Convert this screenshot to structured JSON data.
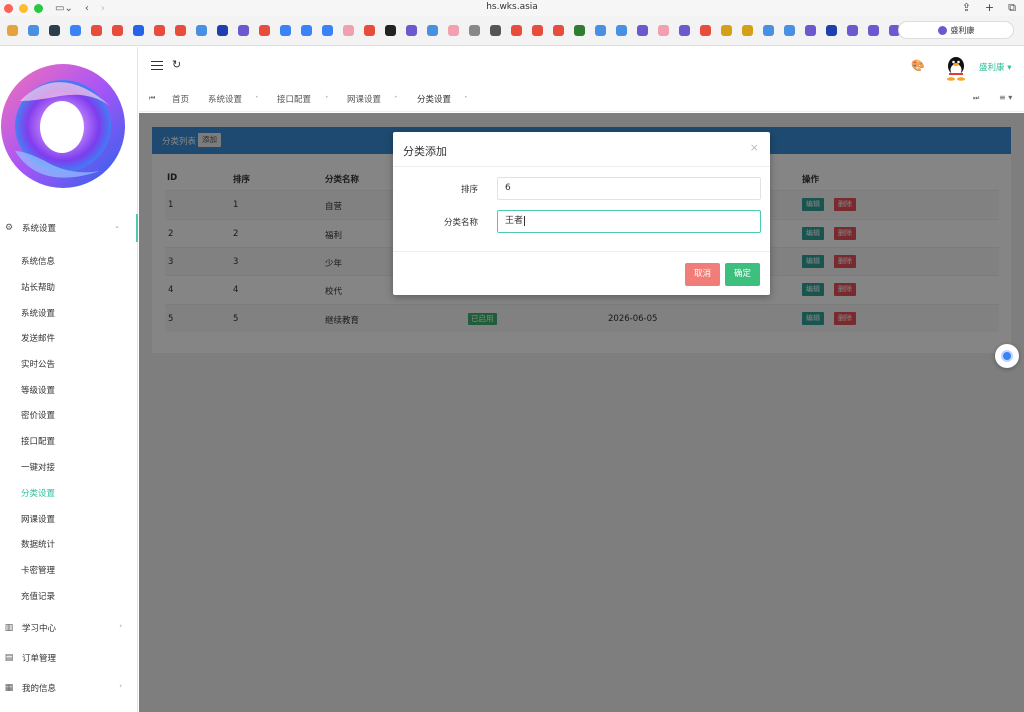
{
  "browser": {
    "url": "hs.wks.asia",
    "search_label": "盛利康"
  },
  "colors": {
    "accent": "#2fbf9a",
    "panel_header": "#3a8fd9",
    "danger": "#e8515a",
    "edit": "#2fa39a",
    "success": "#3cb371"
  },
  "sidebar": {
    "groups": [
      {
        "label": "系统设置",
        "icon": "gear-icon"
      },
      {
        "label": "学习中心",
        "icon": "book-icon"
      },
      {
        "label": "订单管理",
        "icon": "document-icon"
      },
      {
        "label": "我的信息",
        "icon": "grid-icon"
      }
    ],
    "items": [
      "系统信息",
      "站长帮助",
      "系统设置",
      "发送邮件",
      "实时公告",
      "等级设置",
      "密价设置",
      "接口配置",
      "一键对接",
      "分类设置",
      "网课设置",
      "数据统计",
      "卡密管理",
      "充值记录"
    ]
  },
  "header": {
    "username": "盛利康"
  },
  "tabs": [
    "首页",
    "系统设置",
    "接口配置",
    "网课设置",
    "分类设置"
  ],
  "panel": {
    "title": "分类列表",
    "add_label": "添加"
  },
  "table": {
    "headers": [
      "ID",
      "排序",
      "分类名称",
      "操作"
    ],
    "rows": [
      {
        "id": "1",
        "sort": "1",
        "name": "自营"
      },
      {
        "id": "2",
        "sort": "2",
        "name": "福利"
      },
      {
        "id": "3",
        "sort": "3",
        "name": "少年"
      },
      {
        "id": "4",
        "sort": "4",
        "name": "校代"
      },
      {
        "id": "5",
        "sort": "5",
        "name": "继续教育",
        "status": "已启用",
        "date": "2026-06-05"
      }
    ],
    "edit_label": "编辑",
    "delete_label": "删除"
  },
  "modal": {
    "title": "分类添加",
    "close": "×",
    "sort_label": "排序",
    "sort_value": "6",
    "name_label": "分类名称",
    "name_value": "王者",
    "cancel_label": "取消",
    "ok_label": "确定"
  }
}
